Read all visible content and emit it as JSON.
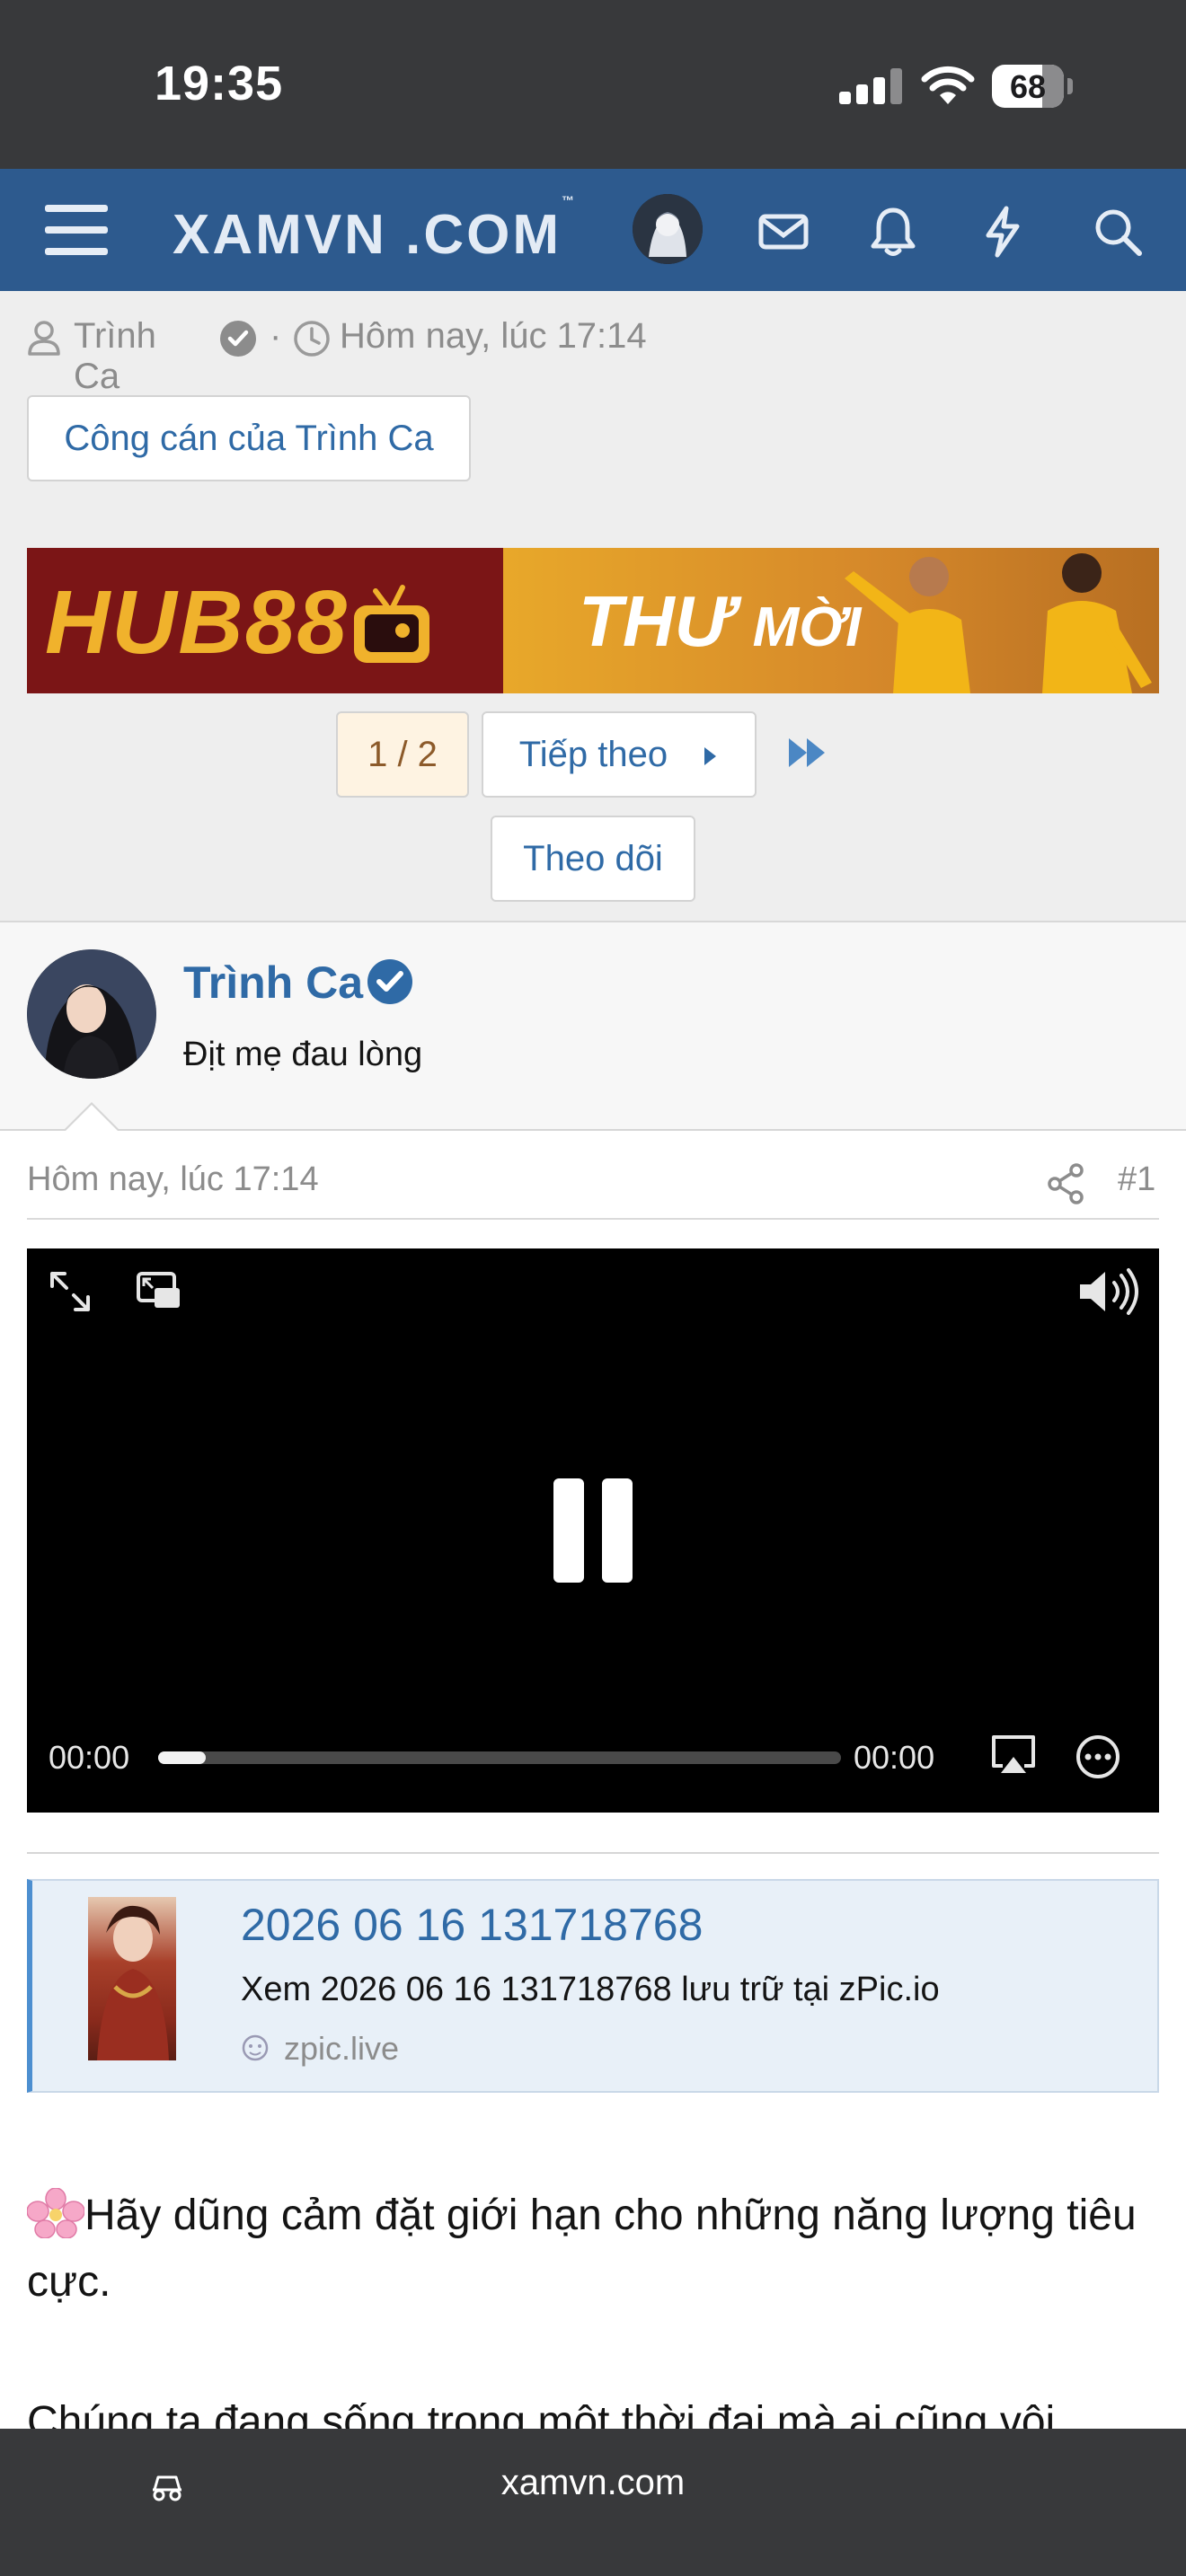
{
  "status_bar": {
    "time": "19:35",
    "battery": "68"
  },
  "site": {
    "logo": "XAMVN",
    "logo_dot": ".COM",
    "logo_tm": "™",
    "brand_color": "#2d5a8e"
  },
  "header_icons": [
    "menu-icon",
    "avatar",
    "mail-icon",
    "bell-icon",
    "lightning-icon",
    "search-icon"
  ],
  "thread": {
    "author": "Trình Ca",
    "meta_separator": "·",
    "date": "Hôm nay, lúc 17:14",
    "tag_button": "Công cán của Trình Ca"
  },
  "ad": {
    "brand": "HUB88",
    "headline_big": "THƯ",
    "headline_small": "MỜI"
  },
  "pagination": {
    "current": "1 / 2",
    "next_label": "Tiếp theo"
  },
  "follow_button": "Theo dõi",
  "post": {
    "author_name": "Trình Ca",
    "author_title": "Địt mẹ đau lòng",
    "date": "Hôm nay, lúc 17:14",
    "number": "#1",
    "video": {
      "current_time": "00:00",
      "duration": "00:00",
      "progress": 0.07
    },
    "embed": {
      "title": "2026 06 16 131718768",
      "description": "Xem 2026 06 16 131718768 lưu trữ tại zPic.io",
      "site": "zpic.live"
    },
    "body_line1": "Hãy dũng cảm đặt giới hạn cho những năng lượng tiêu cực.",
    "body_line2": "Chúng ta đang sống trong một thời đại mà ai cũng vội"
  },
  "browser": {
    "url": "xamvn.com"
  }
}
